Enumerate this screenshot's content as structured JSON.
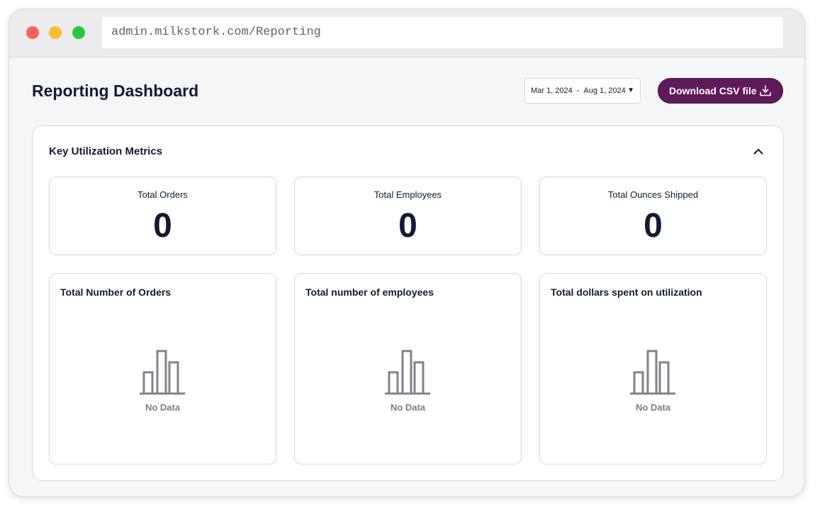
{
  "browser": {
    "url": "admin.milkstork.com/Reporting"
  },
  "header": {
    "title": "Reporting Dashboard",
    "date_range": {
      "start": "Mar 1, 2024",
      "separator": "-",
      "end": "Aug 1, 2024"
    },
    "download_label": "Download CSV file"
  },
  "panel": {
    "title": "Key Utilization Metrics",
    "stats": [
      {
        "label": "Total Orders",
        "value": "0"
      },
      {
        "label": "Total Employees",
        "value": "0"
      },
      {
        "label": "Total Ounces Shipped",
        "value": "0"
      }
    ],
    "charts": [
      {
        "title": "Total Number of Orders",
        "empty_text": "No Data"
      },
      {
        "title": "Total number of employees",
        "empty_text": "No Data"
      },
      {
        "title": "Total dollars spent on utilization",
        "empty_text": "No Data"
      }
    ]
  },
  "colors": {
    "accent": "#5f1a5c",
    "text": "#141a35",
    "muted": "#7b7f8a",
    "background": "#f5f6f8"
  },
  "icons": {
    "download": "download-icon",
    "collapse": "chevron-up-icon",
    "empty_chart": "bar-chart-icon",
    "date_dropdown": "caret-down-icon"
  }
}
